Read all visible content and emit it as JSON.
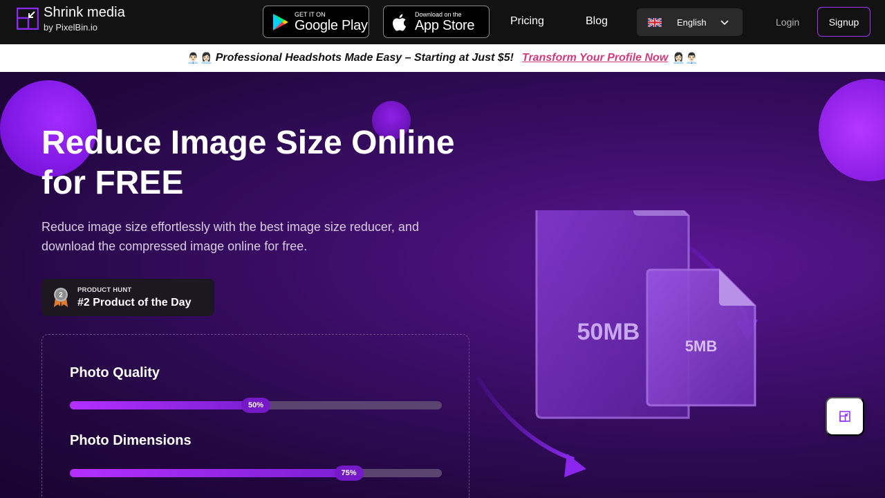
{
  "brand": {
    "name": "Shrink media",
    "sub": "by PixelBin.io"
  },
  "stores": {
    "google_small": "GET IT ON",
    "google_big": "Google Play",
    "apple_small": "Download on the",
    "apple_big": "App Store"
  },
  "nav": {
    "pricing": "Pricing",
    "blog": "Blog",
    "language": "English",
    "login": "Login",
    "signup": "Signup"
  },
  "promo": {
    "emoji_left": "👨🏻‍💼👩🏻‍💼",
    "text": "Professional Headshots Made Easy – Starting at Just $5!",
    "link": "Transform Your Profile Now",
    "emoji_right": "👩🏻‍💼👨🏻‍💼"
  },
  "hero": {
    "title": "Reduce Image Size Online for FREE",
    "description": "Reduce image size effortlessly with the best image size reducer, and download the compressed image online for free."
  },
  "product_hunt": {
    "small": "PRODUCT HUNT",
    "big": "#2 Product of the Day",
    "rank": "2"
  },
  "sliders": [
    {
      "title": "Photo Quality",
      "label": "50%",
      "value": 0.5
    },
    {
      "title": "Photo Dimensions",
      "label": "75%",
      "value": 0.75
    }
  ],
  "illustration": {
    "big_file": "50MB",
    "small_file": "5MB"
  },
  "colors": {
    "accent": "#a634ff",
    "promo_link": "#d03a7d",
    "header_bg": "#121212"
  }
}
